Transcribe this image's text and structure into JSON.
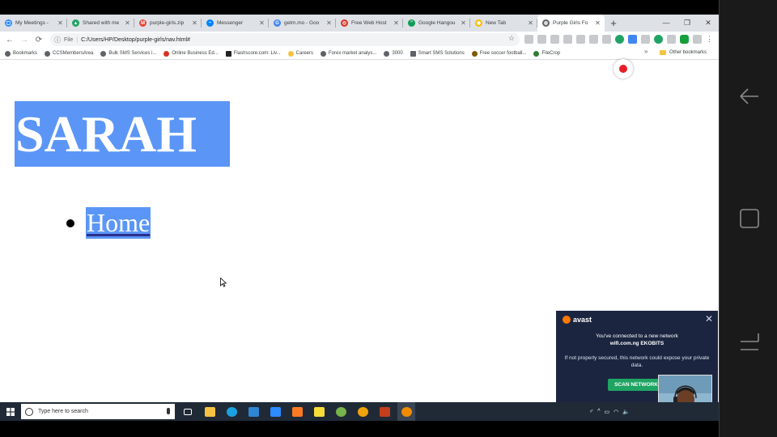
{
  "browser": {
    "tabs": [
      {
        "label": "My Meetings -",
        "color": "#2d8cff",
        "glyph": "▢"
      },
      {
        "label": "Shared with me",
        "color": "#1fa463",
        "glyph": "▲"
      },
      {
        "label": "purple-girls.zip",
        "color": "#ea4335",
        "glyph": "M"
      },
      {
        "label": "Messenger",
        "color": "#0084ff",
        "glyph": "~"
      },
      {
        "label": "getm.mo - Goo",
        "color": "#4285f4",
        "glyph": "G"
      },
      {
        "label": "Free Web Host",
        "color": "#d93025",
        "glyph": "◎"
      },
      {
        "label": "Google Hangou",
        "color": "#0f9d58",
        "glyph": "\""
      },
      {
        "label": "New Tab",
        "color": "#fbbc04",
        "glyph": "◉"
      },
      {
        "label": "Purple Girls Fo",
        "color": "#5f6368",
        "glyph": "◍",
        "active": true
      }
    ],
    "new_tab": "+",
    "window_controls": {
      "minimize": "—",
      "maximize": "❐",
      "close": "✕"
    },
    "nav": {
      "back": "←",
      "forward": "→",
      "reload": "⟳"
    },
    "address": {
      "info_icon": "ⓘ",
      "scheme": "File",
      "separator": "|",
      "url": "C:/Users/HP/Desktop/purple-girls/nav.html#",
      "star": "☆"
    },
    "bookmarks": [
      {
        "label": "Bookmarks",
        "color": "#5f6368"
      },
      {
        "label": "CCSMembersArea",
        "color": "#5f6368"
      },
      {
        "label": "Bulk SMS Services i...",
        "color": "#5f6368"
      },
      {
        "label": "Online Business Ed...",
        "color": "#d93025"
      },
      {
        "label": "Flashscore.com: Liv...",
        "color": "#222"
      },
      {
        "label": "Careers",
        "color": "#f5c342"
      },
      {
        "label": "Forex market analys...",
        "color": "#5f6368"
      },
      {
        "label": "3000",
        "color": "#5f6368"
      },
      {
        "label": "Smart SMS Solutions",
        "color": "#5f6368"
      },
      {
        "label": "Free soccer football...",
        "color": "#7a5c00"
      },
      {
        "label": "FileCrop",
        "color": "#2e7d32"
      }
    ],
    "more_bookmarks": "»",
    "other_bookmarks": "Other bookmarks"
  },
  "page": {
    "title": "SARAH",
    "nav_items": [
      {
        "label": "Home"
      }
    ],
    "accent_color": "#5b96f7"
  },
  "avast": {
    "brand": "avast",
    "line1": "You've connected to a new network",
    "network": "wifi.com.ng EKOBITS",
    "line2": "If not properly secured, this network could expose your private data.",
    "button": "SCAN NETWORK",
    "close": "✕"
  },
  "taskbar": {
    "search_placeholder": "Type here to search",
    "apps": [
      {
        "name": "task-view",
        "color": "#ffffff"
      },
      {
        "name": "file-explorer",
        "color": "#f5c342"
      },
      {
        "name": "edge",
        "color": "#1ba1e2"
      },
      {
        "name": "vscode",
        "color": "#2f86d4"
      },
      {
        "name": "zoom",
        "color": "#2d8cff"
      },
      {
        "name": "xampp",
        "color": "#fb7a24"
      },
      {
        "name": "sticky-notes",
        "color": "#f7dd3a"
      },
      {
        "name": "torrent",
        "color": "#78b34c"
      },
      {
        "name": "chrome-canary",
        "color": "#f0a30a"
      },
      {
        "name": "powerpoint",
        "color": "#c43e1c"
      },
      {
        "name": "vlc",
        "color": "#f08c00"
      }
    ]
  }
}
